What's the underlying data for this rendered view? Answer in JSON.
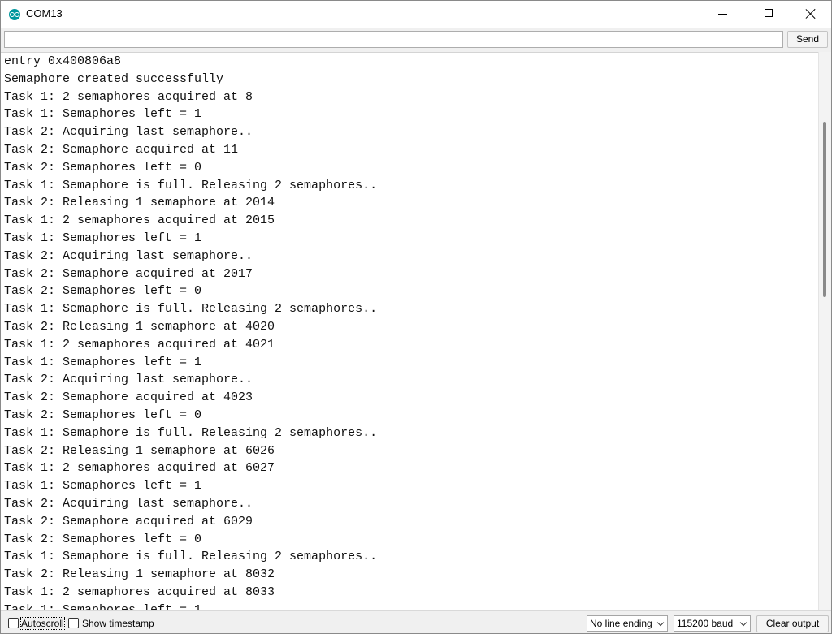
{
  "window": {
    "title": "COM13"
  },
  "send": {
    "input_value": "",
    "button_label": "Send"
  },
  "output": {
    "lines": [
      "entry 0x400806a8",
      "Semaphore created successfully",
      "Task 1: 2 semaphores acquired at 8",
      "Task 1: Semaphores left = 1",
      "Task 2: Acquiring last semaphore..",
      "Task 2: Semaphore acquired at 11",
      "Task 2: Semaphores left = 0",
      "Task 1: Semaphore is full. Releasing 2 semaphores..",
      "Task 2: Releasing 1 semaphore at 2014",
      "Task 1: 2 semaphores acquired at 2015",
      "Task 1: Semaphores left = 1",
      "Task 2: Acquiring last semaphore..",
      "Task 2: Semaphore acquired at 2017",
      "Task 2: Semaphores left = 0",
      "Task 1: Semaphore is full. Releasing 2 semaphores..",
      "Task 2: Releasing 1 semaphore at 4020",
      "Task 1: 2 semaphores acquired at 4021",
      "Task 1: Semaphores left = 1",
      "Task 2: Acquiring last semaphore..",
      "Task 2: Semaphore acquired at 4023",
      "Task 2: Semaphores left = 0",
      "Task 1: Semaphore is full. Releasing 2 semaphores..",
      "Task 2: Releasing 1 semaphore at 6026",
      "Task 1: 2 semaphores acquired at 6027",
      "Task 1: Semaphores left = 1",
      "Task 2: Acquiring last semaphore..",
      "Task 2: Semaphore acquired at 6029",
      "Task 2: Semaphores left = 0",
      "Task 1: Semaphore is full. Releasing 2 semaphores..",
      "Task 2: Releasing 1 semaphore at 8032",
      "Task 1: 2 semaphores acquired at 8033",
      "Task 1: Semaphores left = 1"
    ]
  },
  "statusbar": {
    "autoscroll_label": "Autoscroll",
    "autoscroll_checked": false,
    "timestamp_label": "Show timestamp",
    "timestamp_checked": false,
    "line_ending": "No line ending",
    "baud_rate": "115200 baud",
    "clear_label": "Clear output"
  },
  "icons": {
    "app": "arduino-icon",
    "minimize": "minimize-icon",
    "maximize": "maximize-icon",
    "close": "close-icon"
  },
  "colors": {
    "app_icon": "#00979d"
  }
}
